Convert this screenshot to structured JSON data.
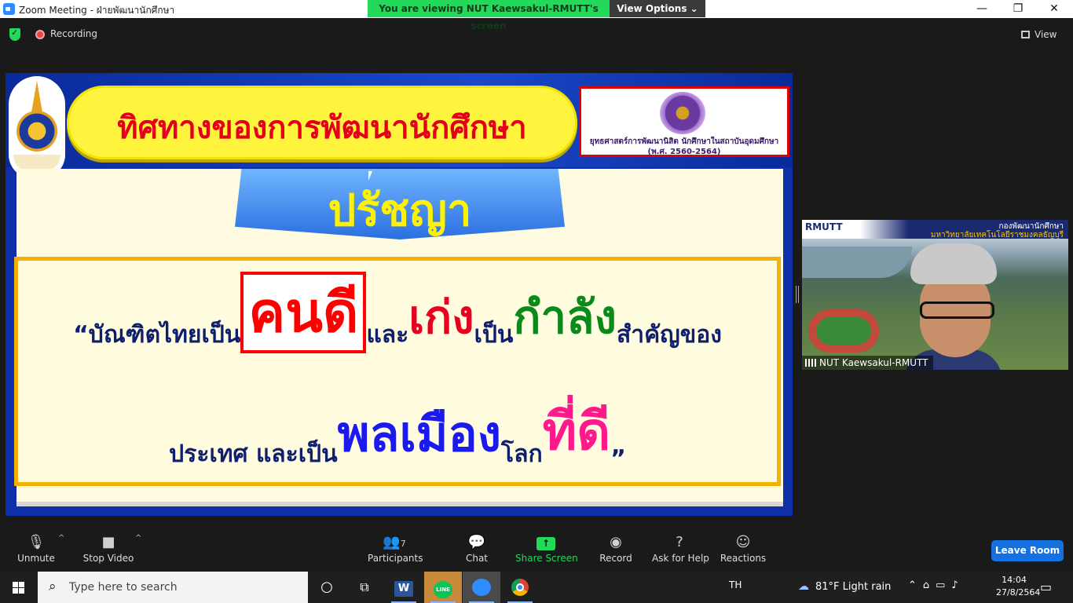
{
  "window": {
    "title": "Zoom Meeting - ฝ่ายพัฒนานักศึกษา",
    "minimize_glyph": "—",
    "restore_glyph": "❐",
    "close_glyph": "✕"
  },
  "viewing_banner": {
    "message": "You are viewing NUT Kaewsakul-RMUTT's screen",
    "view_options": "View Options ⌄"
  },
  "status": {
    "recording": "Recording",
    "view": "View"
  },
  "slide": {
    "title": "ทิศทางของการพัฒนานักศึกษา",
    "strategy_line1": "ยุทธศาสตร์การพัฒนานิสิต นักศึกษาในสถาบันอุดมศึกษา",
    "strategy_line2": "(พ.ศ. 2560-2564)",
    "philosophy": "ปรัชญา",
    "quote": {
      "open": "“บัณฑิตไทยเป็น",
      "kondee": "คนดี",
      "and": "และ",
      "keng": "เก่ง",
      "pen": " เป็น",
      "kamlang": "กำลัง",
      "samkhan": "สำคัญของ",
      "prathet": "ประเทศ และเป็น",
      "ponmuang": "พลเมือง",
      "lok": "โลก",
      "teedee": "ที่ดี",
      "close": "”"
    }
  },
  "video": {
    "banner_logo": "RMUTT",
    "banner_line1": "กองพัฒนานักศึกษา",
    "banner_line2": "มหาวิทยาลัยเทคโนโลยีราชมงคลธัญบุรี",
    "participant_name": "NUT Kaewsakul-RMUTT"
  },
  "toolbar": {
    "unmute": "Unmute",
    "stop_video": "Stop Video",
    "participants": "Participants",
    "participants_count": "7",
    "chat": "Chat",
    "share_screen": "Share Screen",
    "record": "Record",
    "ask_for_help": "Ask for Help",
    "reactions": "Reactions",
    "leave_room": "Leave Room",
    "caret": "^"
  },
  "taskbar": {
    "search_placeholder": "Type here to search",
    "language": "TH",
    "weather": "81°F  Light rain",
    "time": "14:04",
    "date": "27/8/2564",
    "word_letter": "W",
    "line_label": "LINE"
  },
  "colors": {
    "accent_green": "#23d959",
    "leave_blue": "#1671e0",
    "slide_title_red": "#e4001b",
    "slide_yellow": "#fff43d"
  },
  "icons": [
    "shield-icon",
    "record-dot-icon",
    "grid-view-icon",
    "mic-muted-icon",
    "camera-icon",
    "participants-icon",
    "chat-icon",
    "share-screen-icon",
    "record-icon",
    "help-icon",
    "reactions-icon",
    "windows-start-icon",
    "search-icon",
    "cortana-icon",
    "task-view-icon",
    "word-icon",
    "line-icon",
    "zoom-icon",
    "chrome-icon",
    "cloud-icon",
    "notification-icon"
  ]
}
